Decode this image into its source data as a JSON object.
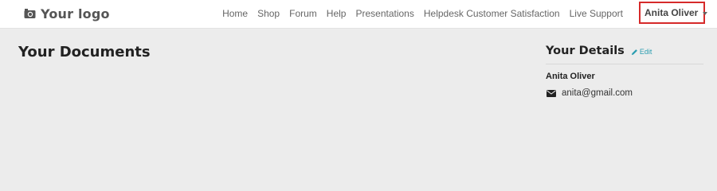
{
  "brand": {
    "logo_text": "Your logo",
    "logo_icon": "camera-icon"
  },
  "nav": {
    "items": [
      {
        "label": "Home"
      },
      {
        "label": "Shop"
      },
      {
        "label": "Forum"
      },
      {
        "label": "Help"
      },
      {
        "label": "Presentations"
      },
      {
        "label": "Helpdesk Customer Satisfaction"
      },
      {
        "label": "Live Support"
      }
    ],
    "user": {
      "name": "Anita Oliver",
      "icon": "caret-down-icon"
    }
  },
  "documents": {
    "title": "Your Documents"
  },
  "details": {
    "title": "Your Details",
    "edit_label": "Edit",
    "edit_icon": "pencil-icon",
    "name": "Anita Oliver",
    "email": "anita@gmail.com",
    "email_icon": "envelope-icon"
  },
  "colors": {
    "page_background": "#ececec",
    "navbar_background": "#ffffff",
    "highlight_border": "#d62a2a",
    "link": "#2a9db0"
  }
}
